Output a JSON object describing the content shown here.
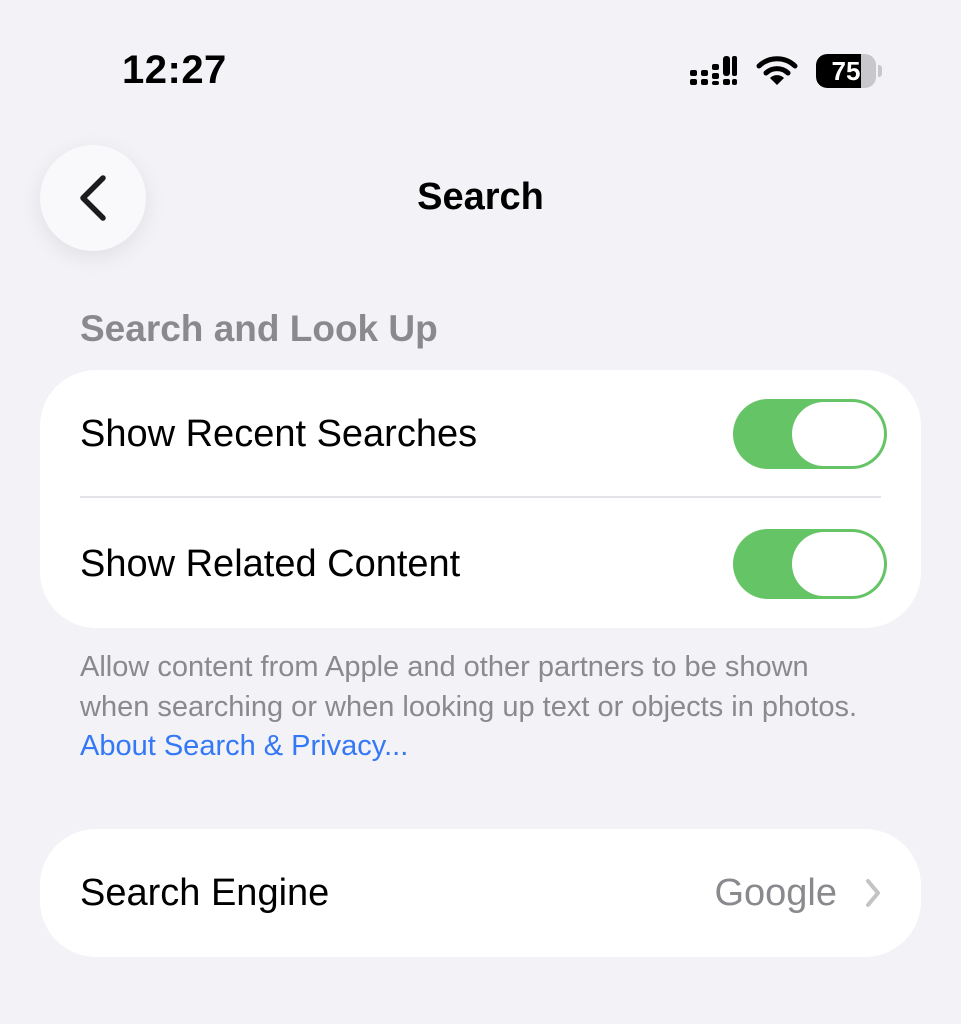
{
  "status_bar": {
    "time": "12:27",
    "battery_level": "75",
    "battery_fraction": 0.75,
    "icons": [
      "signal-icon",
      "wifi-icon",
      "battery-icon"
    ]
  },
  "nav": {
    "back_icon": "chevron-left-icon",
    "title": "Search"
  },
  "section": {
    "header": "Search and Look Up",
    "rows": [
      {
        "label": "Show Recent Searches",
        "toggle_on": true
      },
      {
        "label": "Show Related Content",
        "toggle_on": true
      }
    ],
    "footer": {
      "text": "Allow content from Apple and other partners to be shown when searching or when looking up text or objects in photos. ",
      "link": "About Search & Privacy..."
    }
  },
  "engine_row": {
    "label": "Search Engine",
    "value": "Google",
    "icon": "chevron-right-icon"
  },
  "colors": {
    "background": "#f2f2f7",
    "toggle_on": "#65c466",
    "link": "#3478f6",
    "secondary_text": "#8a8a8e"
  }
}
